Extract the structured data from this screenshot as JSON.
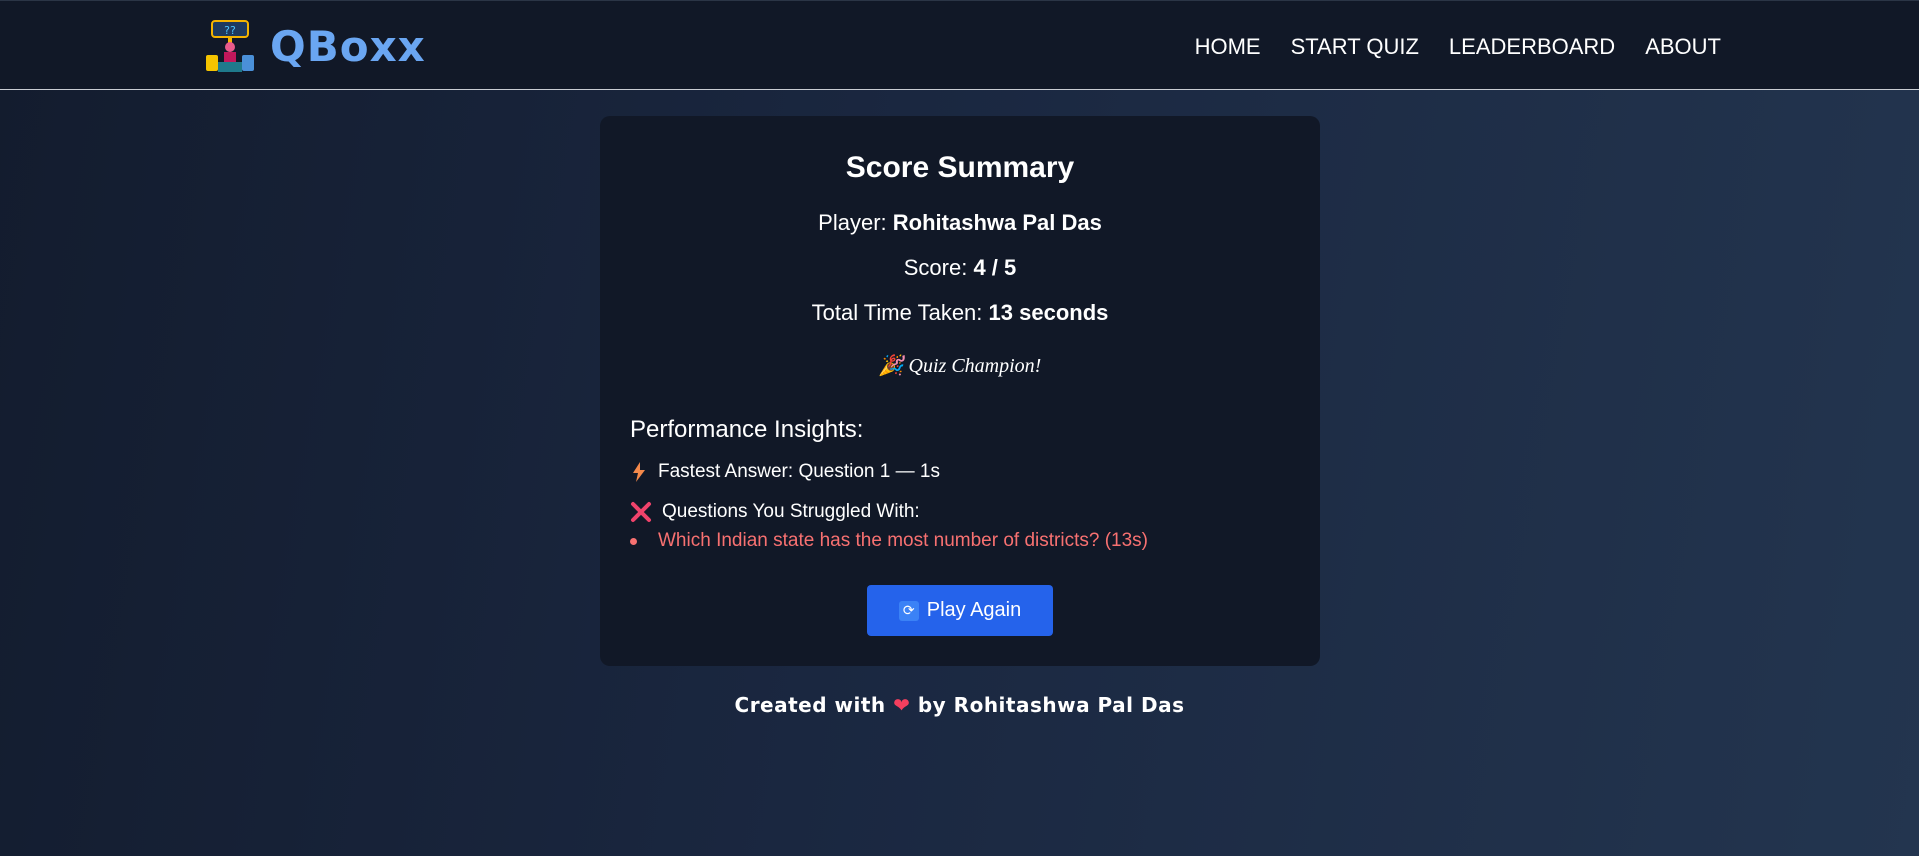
{
  "header": {
    "brand": "QBoxx",
    "nav": [
      "HOME",
      "START QUIZ",
      "LEADERBOARD",
      "ABOUT"
    ]
  },
  "summary": {
    "title": "Score Summary",
    "player_label": "Player:",
    "player_name": "Rohitashwa Pal Das",
    "score_label": "Score:",
    "score_value": "4 / 5",
    "time_label": "Total Time Taken:",
    "time_value": "13 seconds",
    "badge_icon": "🎉",
    "badge_text": "Quiz Champion!"
  },
  "insights": {
    "title": "Performance Insights:",
    "fastest_icon": "lightning-icon",
    "fastest_text": "Fastest Answer: Question 1 — 1s",
    "struggled_icon": "cross-icon",
    "struggled_text": "Questions You Struggled With:",
    "struggled_items": [
      "Which Indian state has the most number of districts? (13s)"
    ]
  },
  "actions": {
    "play_again_label": "Play Again",
    "play_again_icon": "refresh-icon"
  },
  "footer": {
    "prefix": "Created with",
    "heart": "❤",
    "suffix": "by Rohitashwa Pal Das"
  },
  "colors": {
    "accent": "#2563eb",
    "brand": "#6aa6f2",
    "error": "#f87171",
    "card_bg": "#111827"
  }
}
